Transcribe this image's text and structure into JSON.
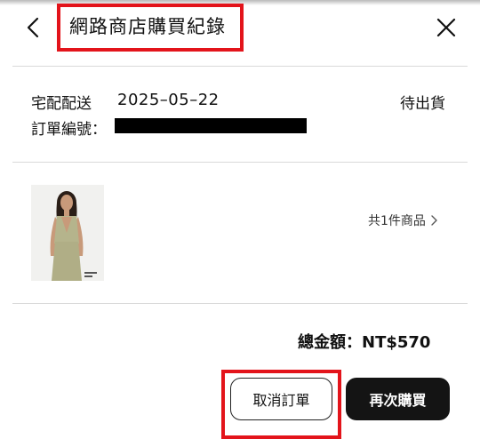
{
  "header": {
    "back_icon": "chevron-left-icon",
    "title": "網路商店購買紀錄",
    "close_icon": "close-icon",
    "highlight_color": "#e3141b"
  },
  "order": {
    "delivery_method": "宅配配送",
    "date": "2025–05–22",
    "status": "待出貨",
    "order_number_label": "訂單編號："
  },
  "product": {
    "item_count": "共1件商品",
    "chevron_icon": "chevron-right-icon"
  },
  "summary": {
    "total": "總金額：NT$570"
  },
  "actions": {
    "cancel_label": "取消訂單",
    "rebuy_label": "再次購買"
  }
}
